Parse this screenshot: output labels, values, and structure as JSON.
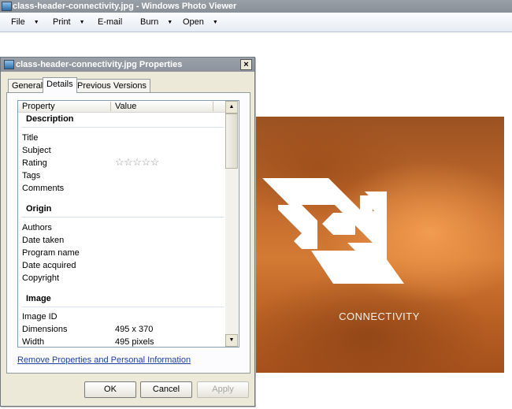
{
  "window": {
    "title": "class-header-connectivity.jpg - Windows Photo Viewer"
  },
  "menu": [
    {
      "label": "File",
      "has_dropdown": true
    },
    {
      "label": "Print",
      "has_dropdown": true
    },
    {
      "label": "E-mail",
      "has_dropdown": false
    },
    {
      "label": "Burn",
      "has_dropdown": true
    },
    {
      "label": "Open",
      "has_dropdown": true
    }
  ],
  "dialog": {
    "title": "class-header-connectivity.jpg Properties",
    "close_symbol": "×",
    "tabs": [
      "General",
      "Details",
      "Previous Versions"
    ],
    "active_tab": "Details",
    "columns": {
      "property": "Property",
      "value": "Value"
    },
    "groups": {
      "description": {
        "title": "Description",
        "rows": [
          {
            "property": "Title",
            "value": ""
          },
          {
            "property": "Subject",
            "value": ""
          },
          {
            "property": "Rating",
            "value": "☆☆☆☆☆"
          },
          {
            "property": "Tags",
            "value": ""
          },
          {
            "property": "Comments",
            "value": ""
          }
        ]
      },
      "origin": {
        "title": "Origin",
        "rows": [
          {
            "property": "Authors",
            "value": ""
          },
          {
            "property": "Date taken",
            "value": ""
          },
          {
            "property": "Program name",
            "value": ""
          },
          {
            "property": "Date acquired",
            "value": ""
          },
          {
            "property": "Copyright",
            "value": ""
          }
        ]
      },
      "image": {
        "title": "Image",
        "rows": [
          {
            "property": "Image ID",
            "value": ""
          },
          {
            "property": "Dimensions",
            "value": "495 x 370"
          },
          {
            "property": "Width",
            "value": "495 pixels"
          }
        ]
      }
    },
    "remove_link": "Remove Properties and Personal Information",
    "buttons": {
      "ok": "OK",
      "cancel": "Cancel",
      "apply": "Apply"
    }
  },
  "photo": {
    "caption": "CONNECTIVITY"
  },
  "colors": {
    "title_bar": "#9aa0a8",
    "dialog_face": "#ece9d8",
    "link": "#1b3fa5",
    "photo_orange": "#c26a2c"
  },
  "icons": [
    "app-icon",
    "close-icon",
    "dropdown-arrow-icon",
    "scroll-up-icon",
    "scroll-down-icon",
    "star-icon",
    "connectivity-logo"
  ]
}
